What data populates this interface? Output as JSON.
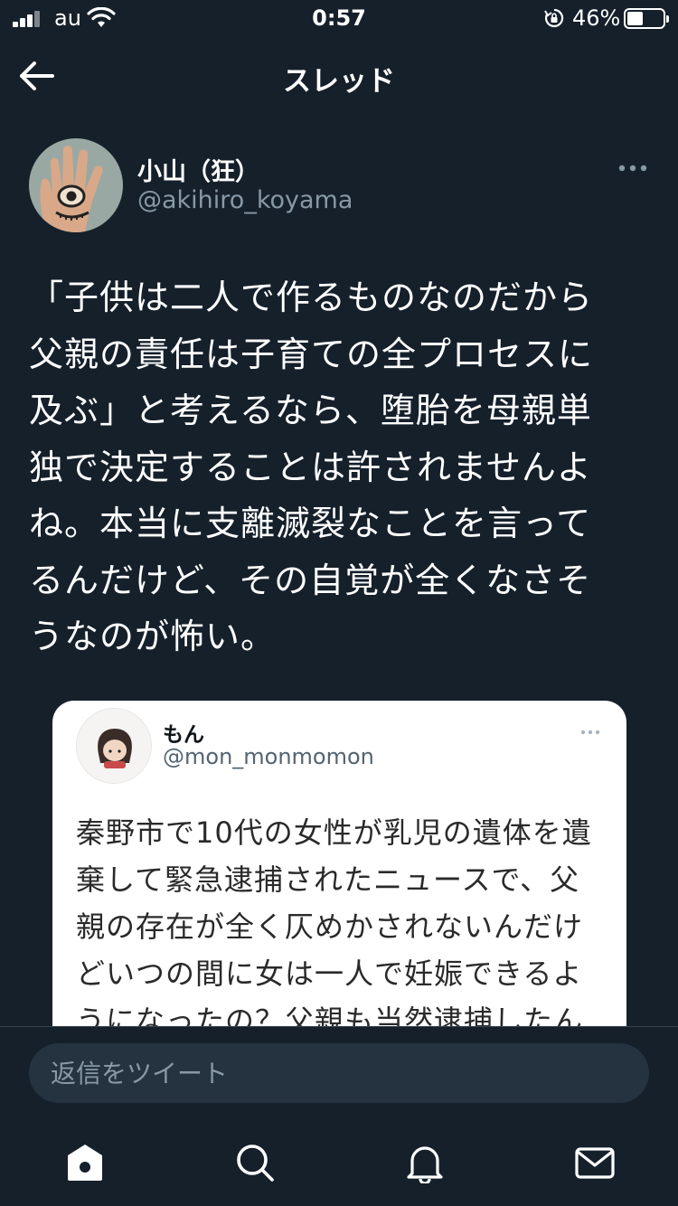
{
  "status_bar": {
    "carrier": "au",
    "time": "0:57",
    "battery_percent": "46%",
    "battery_level": 0.46,
    "icons": [
      "signal-icon",
      "wifi-icon",
      "orientation-lock-icon",
      "battery-icon"
    ]
  },
  "header": {
    "title": "スレッド",
    "back_icon": "back-arrow-icon"
  },
  "tweet": {
    "display_name": "小山（狂）",
    "handle": "@akihiro_koyama",
    "text": "「子供は二人で作るものなのだから\n父親の責任は子育ての全プロセスに\n及ぶ」と考えるなら、堕胎を母親単\n独で決定することは許されませんよ\nね。本当に支離滅裂なことを言って\nるんだけど、その自覚が全くなさそ\nうなのが怖い。",
    "more_icon": "more-icon"
  },
  "quoted_tweet": {
    "display_name": "もん",
    "handle": "@mon_monmomon",
    "text": "秦野市で10代の女性が乳児の遺体を遺\n棄して緊急逮捕されたニュースで、父\n親の存在が全く仄めかされないんだけ\nどいつの間に女は一人で妊娠できるよ\nうになったの？父親も当然逮捕したん"
  },
  "reply": {
    "placeholder": "返信をツイート"
  },
  "tabbar": {
    "items": [
      "home-icon",
      "search-icon",
      "notifications-icon",
      "messages-icon"
    ]
  },
  "colors": {
    "background": "#15202b",
    "secondary_text": "#8899a6",
    "input_background": "#253341",
    "card_background": "#ffffff"
  }
}
